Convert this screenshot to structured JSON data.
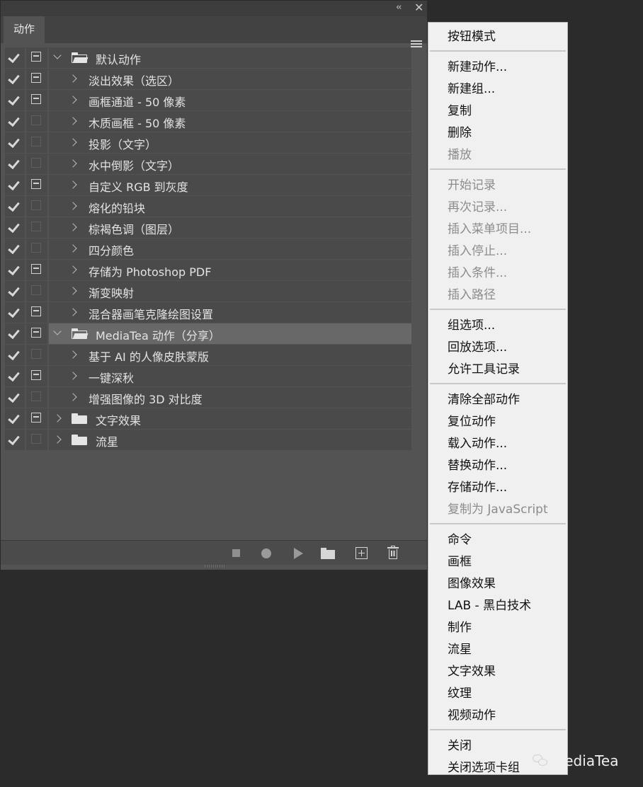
{
  "panel": {
    "tab_label": "动作",
    "collapse_glyph": "‹‹",
    "close_glyph": "✕",
    "rows": [
      {
        "label": "默认动作",
        "level": 0,
        "checked": true,
        "dialog": true,
        "expanded": true,
        "folder": "open"
      },
      {
        "label": "淡出效果（选区）",
        "level": 1,
        "checked": true,
        "dialog": true
      },
      {
        "label": "画框通道 - 50 像素",
        "level": 1,
        "checked": true,
        "dialog": true
      },
      {
        "label": "木质画框 - 50 像素",
        "level": 1,
        "checked": true,
        "dialog": false
      },
      {
        "label": "投影（文字）",
        "level": 1,
        "checked": true,
        "dialog": false
      },
      {
        "label": "水中倒影（文字）",
        "level": 1,
        "checked": true,
        "dialog": false
      },
      {
        "label": "自定义 RGB 到灰度",
        "level": 1,
        "checked": true,
        "dialog": true
      },
      {
        "label": "熔化的铅块",
        "level": 1,
        "checked": true,
        "dialog": false
      },
      {
        "label": "棕褐色调（图层）",
        "level": 1,
        "checked": true,
        "dialog": false
      },
      {
        "label": "四分颜色",
        "level": 1,
        "checked": true,
        "dialog": false
      },
      {
        "label": "存储为 Photoshop PDF",
        "level": 1,
        "checked": true,
        "dialog": true
      },
      {
        "label": "渐变映射",
        "level": 1,
        "checked": true,
        "dialog": false
      },
      {
        "label": "混合器画笔克隆绘图设置",
        "level": 1,
        "checked": true,
        "dialog": true
      },
      {
        "label": "MediaTea 动作（分享）",
        "level": 0,
        "checked": true,
        "dialog": true,
        "expanded": true,
        "folder": "open",
        "selected": true
      },
      {
        "label": "基于 AI 的人像皮肤蒙版",
        "level": 1,
        "checked": true,
        "dialog": false
      },
      {
        "label": "一键深秋",
        "level": 1,
        "checked": true,
        "dialog": true
      },
      {
        "label": "增强图像的 3D 对比度",
        "level": 1,
        "checked": true,
        "dialog": false
      },
      {
        "label": "文字效果",
        "level": 0,
        "checked": true,
        "dialog": true,
        "expanded": false,
        "folder": "closed"
      },
      {
        "label": "流星",
        "level": 0,
        "checked": true,
        "dialog": false,
        "expanded": false,
        "folder": "closed"
      }
    ],
    "toolbar": [
      "stop-icon",
      "record-icon",
      "play-icon",
      "new-set-icon",
      "new-action-icon",
      "delete-icon"
    ]
  },
  "menu": {
    "groups": [
      [
        {
          "label": "按钮模式",
          "enabled": true
        }
      ],
      [
        {
          "label": "新建动作...",
          "enabled": true
        },
        {
          "label": "新建组...",
          "enabled": true
        },
        {
          "label": "复制",
          "enabled": true
        },
        {
          "label": "删除",
          "enabled": true
        },
        {
          "label": "播放",
          "enabled": false
        }
      ],
      [
        {
          "label": "开始记录",
          "enabled": false
        },
        {
          "label": "再次记录...",
          "enabled": false
        },
        {
          "label": "插入菜单项目...",
          "enabled": false
        },
        {
          "label": "插入停止...",
          "enabled": false
        },
        {
          "label": "插入条件...",
          "enabled": false
        },
        {
          "label": "插入路径",
          "enabled": false
        }
      ],
      [
        {
          "label": "组选项...",
          "enabled": true
        },
        {
          "label": "回放选项...",
          "enabled": true
        },
        {
          "label": "允许工具记录",
          "enabled": true
        }
      ],
      [
        {
          "label": "清除全部动作",
          "enabled": true
        },
        {
          "label": "复位动作",
          "enabled": true
        },
        {
          "label": "载入动作...",
          "enabled": true
        },
        {
          "label": "替换动作...",
          "enabled": true
        },
        {
          "label": "存储动作...",
          "enabled": true
        },
        {
          "label": "复制为 JavaScript",
          "enabled": false
        }
      ],
      [
        {
          "label": "命令",
          "enabled": true
        },
        {
          "label": "画框",
          "enabled": true
        },
        {
          "label": "图像效果",
          "enabled": true
        },
        {
          "label": "LAB - 黑白技术",
          "enabled": true
        },
        {
          "label": "制作",
          "enabled": true
        },
        {
          "label": "流星",
          "enabled": true
        },
        {
          "label": "文字效果",
          "enabled": true
        },
        {
          "label": "纹理",
          "enabled": true
        },
        {
          "label": "视频动作",
          "enabled": true
        }
      ],
      [
        {
          "label": "关闭",
          "enabled": true
        },
        {
          "label": "关闭选项卡组",
          "enabled": true
        }
      ]
    ]
  },
  "watermark": {
    "text": "MediaTea"
  }
}
